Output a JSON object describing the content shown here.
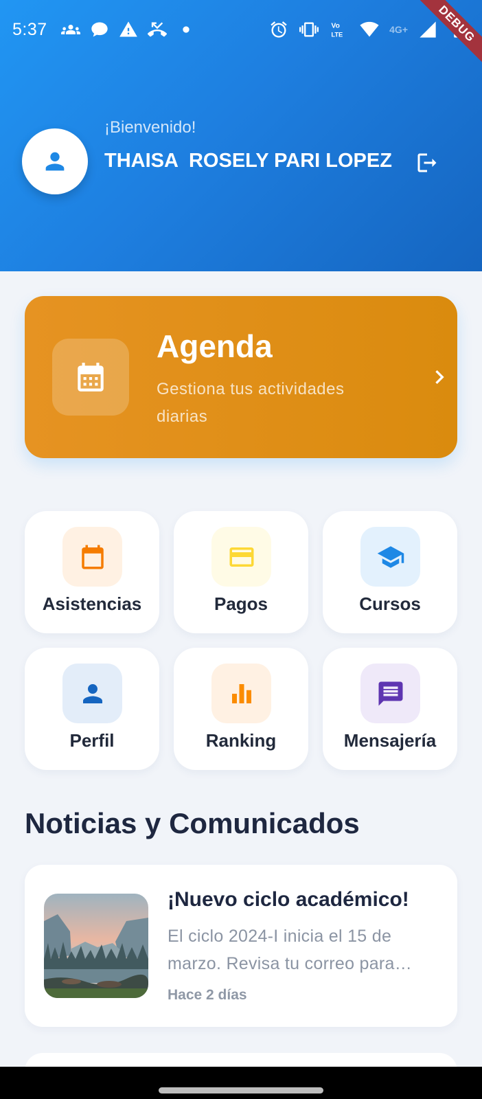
{
  "status_bar": {
    "time": "5:37",
    "left_icons": [
      "group-icon",
      "chat-bubble-icon",
      "warning-icon",
      "call-missed-icon",
      "dot-icon"
    ],
    "right_icons": [
      "alarm-icon",
      "vibrate-icon",
      "volte-icon",
      "wifi-icon",
      "signal-icon",
      "battery-icon"
    ],
    "network_label": "4G+",
    "debug_banner": "DEBUG"
  },
  "header": {
    "welcome": "¡Bienvenido!",
    "user_name": "THAISA  ROSELY PARI LOPEZ",
    "avatar_icon": "person-icon",
    "logout_icon": "logout-icon",
    "gradient_start": "#2196f3",
    "gradient_end": "#1565c0"
  },
  "agenda": {
    "title": "Agenda",
    "subtitle": "Gestiona tus actividades diarias",
    "icon": "calendar-icon",
    "color": "#e08f18"
  },
  "menu": {
    "items": [
      {
        "label": "Asistencias",
        "icon": "calendar-icon",
        "icon_color": "#f57c00",
        "bg_color": "#fff1e3"
      },
      {
        "label": "Pagos",
        "icon": "credit-card-icon",
        "icon_color": "#fdd835",
        "bg_color": "#fffbe6"
      },
      {
        "label": "Cursos",
        "icon": "graduation-cap-icon",
        "icon_color": "#1e88e5",
        "bg_color": "#e3f1fd"
      },
      {
        "label": "Perfil",
        "icon": "person-icon",
        "icon_color": "#1565c0",
        "bg_color": "#e3edf9"
      },
      {
        "label": "Ranking",
        "icon": "bar-chart-icon",
        "icon_color": "#fb8c00",
        "bg_color": "#fff1e3"
      },
      {
        "label": "Mensajería",
        "icon": "message-icon",
        "icon_color": "#5e35b1",
        "bg_color": "#efe9f9"
      }
    ]
  },
  "news": {
    "section_title": "Noticias y Comunicados",
    "items": [
      {
        "title": "¡Nuevo ciclo académico!",
        "body": "El ciclo 2024-I inicia el 15 de marzo. Revisa tu correo para…",
        "time": "Hace 2 días"
      }
    ]
  }
}
